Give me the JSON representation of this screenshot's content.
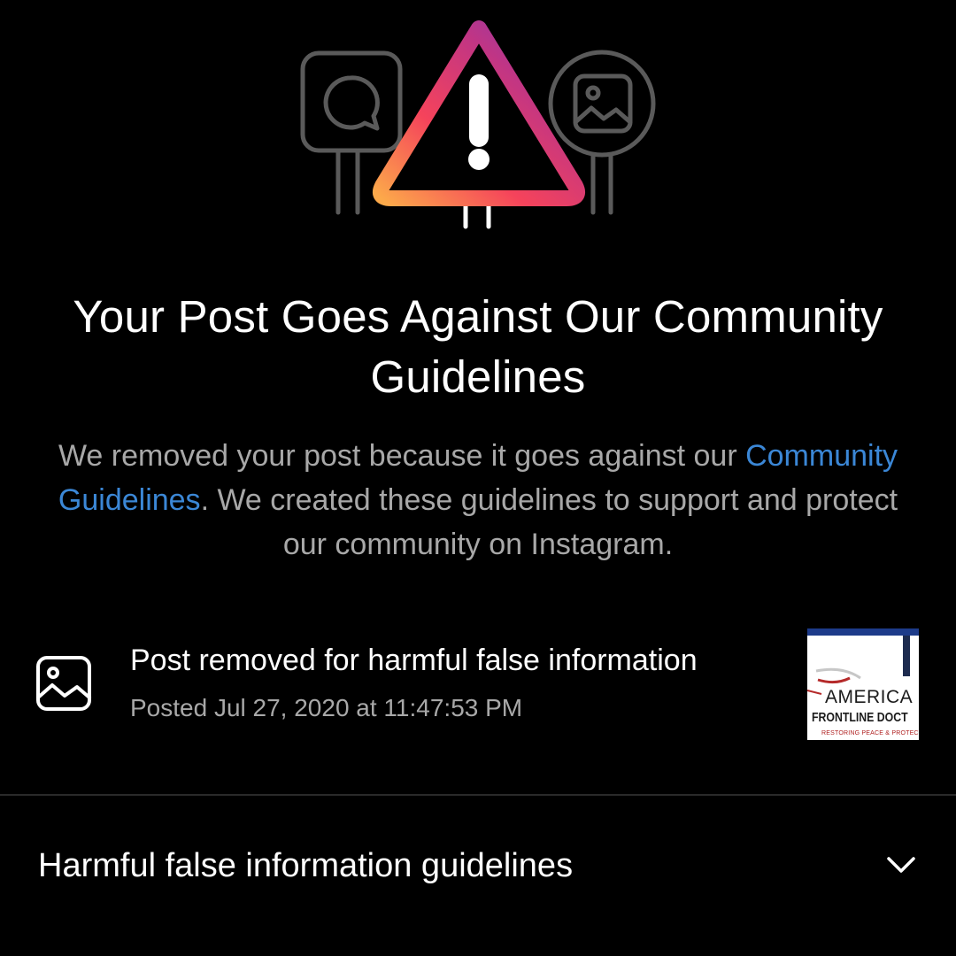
{
  "hero": {
    "icons": [
      "comment-sign-icon",
      "warning-triangle-icon",
      "photo-sign-icon"
    ],
    "gradient": [
      "#fca94a",
      "#f5435b",
      "#c13584",
      "#833ab4"
    ]
  },
  "main": {
    "title": "Your Post Goes Against Our Community Guidelines",
    "description_before": "We removed your post because it goes against our ",
    "description_link": "Community Guidelines",
    "description_after": ". We created these guidelines to support and protect our community on Instagram."
  },
  "removal": {
    "title": "Post removed for harmful false information",
    "posted": "Posted Jul 27, 2020 at 11:47:53 PM",
    "thumbnail": {
      "line1": "AMERICA",
      "line2": "FRONTLINE DOCT",
      "line3": "RESTORING PEACE & PROTECTING FR"
    }
  },
  "guidelines": {
    "label": "Harmful false information guidelines",
    "icon": "chevron-down-icon"
  },
  "colors": {
    "background": "#000000",
    "text": "#ffffff",
    "secondary_text": "#a8a8a8",
    "link": "#3b87d6"
  }
}
